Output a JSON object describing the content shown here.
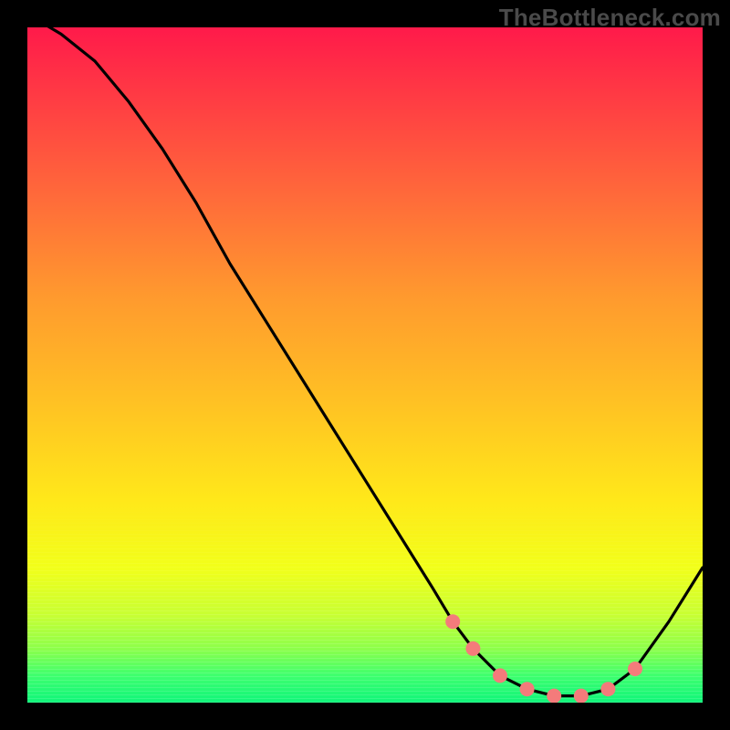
{
  "watermark": "TheBottleneck.com",
  "chart_data": {
    "type": "line",
    "title": "",
    "xlabel": "",
    "ylabel": "",
    "xlim": [
      0,
      100
    ],
    "ylim": [
      0,
      100
    ],
    "series": [
      {
        "name": "curve",
        "x": [
          0,
          5,
          10,
          15,
          20,
          25,
          30,
          35,
          40,
          45,
          50,
          55,
          60,
          63,
          66,
          70,
          74,
          78,
          82,
          86,
          90,
          95,
          100
        ],
        "values": [
          102,
          99,
          95,
          89,
          82,
          74,
          65,
          57,
          49,
          41,
          33,
          25,
          17,
          12,
          8,
          4,
          2,
          1,
          1,
          2,
          5,
          12,
          20
        ]
      }
    ],
    "markers": {
      "name": "highlight-points",
      "x": [
        63,
        66,
        70,
        74,
        78,
        82,
        86,
        90
      ],
      "values": [
        12,
        8,
        4,
        2,
        1,
        1,
        2,
        5
      ]
    },
    "colors": {
      "curve": "#000000",
      "marker_fill": "#f47b7b",
      "gradient_top": "#ff1a4a",
      "gradient_mid": "#ffe81a",
      "gradient_bottom": "#10f57a"
    }
  }
}
